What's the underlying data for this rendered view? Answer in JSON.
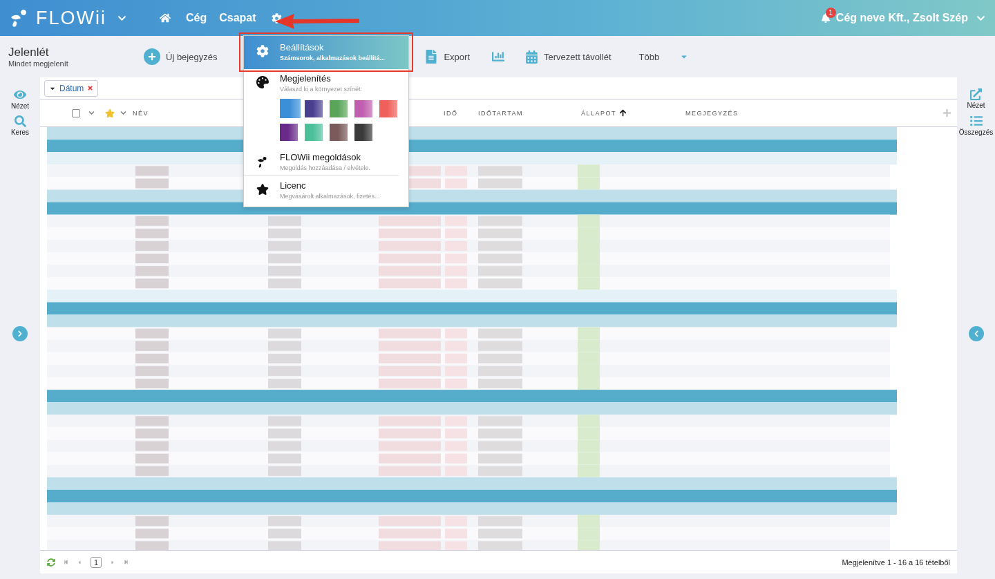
{
  "header": {
    "logo": "FLOWii",
    "nav": [
      {
        "kind": "home"
      },
      {
        "kind": "text",
        "label": "Cég"
      },
      {
        "kind": "text",
        "label": "Csapat"
      },
      {
        "kind": "settings"
      }
    ],
    "notifications": "1",
    "user": "Cég neve Kft., Zsolt Szép"
  },
  "page": {
    "title": "Jelenlét",
    "subtitle": "Mindet megjelenít"
  },
  "toolbar": [
    {
      "kind": "add",
      "label": "Új bejegyzés"
    },
    {
      "kind": "export",
      "label": "Export"
    },
    {
      "kind": "chart"
    },
    {
      "kind": "calendar",
      "label": "Tervezett távollét"
    },
    {
      "kind": "more",
      "label": "Több"
    }
  ],
  "left_sidebar": [
    {
      "kind": "eye",
      "label": "Nézet"
    },
    {
      "kind": "search",
      "label": "Keres"
    }
  ],
  "right_sidebar": [
    {
      "kind": "external",
      "label": "Nézet"
    },
    {
      "kind": "list",
      "label": "Összegzés"
    }
  ],
  "filter": {
    "label": "Dátum"
  },
  "table": {
    "columns": [
      {
        "kind": "checkbox",
        "checked": false
      },
      {
        "kind": "star"
      },
      {
        "kind": "text",
        "label": "NÉV"
      },
      {
        "kind": "text",
        "label": "IDŐ"
      },
      {
        "kind": "text",
        "label": "IDŐTARTAM"
      },
      {
        "kind": "sort",
        "label": "ÁLLAPOT"
      },
      {
        "kind": "text",
        "label": "MEGJEGYZÉS"
      }
    ]
  },
  "menu": [
    {
      "kind": "settings",
      "title": "Beállítások",
      "subtitle": "Számsorok, alkalmazások beállítá...",
      "selected": true
    },
    {
      "kind": "appearance",
      "title": "Megjelenítés",
      "subtitle": "Válaszd ki a környezet színét:",
      "selected": false,
      "swatches": [
        {
          "color": "#3b8fd9",
          "selected": true
        },
        {
          "color": "#4a3f8f",
          "selected": false
        },
        {
          "color": "#5aa55a",
          "selected": false
        },
        {
          "color": "#c05fb0",
          "selected": false
        },
        {
          "color": "#f0605a",
          "selected": false
        },
        {
          "color": "#6a2a8a",
          "selected": false
        },
        {
          "color": "#4cc09a",
          "selected": false
        },
        {
          "color": "#7a5a5a",
          "selected": false
        },
        {
          "color": "#3a3a3a",
          "selected": false
        }
      ]
    },
    {
      "kind": "solutions",
      "title": "FLOWii megoldások",
      "subtitle": "Megoldás hozzáadása / elvétele.",
      "selected": false
    },
    {
      "kind": "license",
      "title": "Licenc",
      "subtitle": "Megvásárolt alkalmazások, fizetés...",
      "selected": false
    }
  ],
  "footer": {
    "page": "1",
    "status": "Megjelenítve 1 - 16 a 16 tételből"
  }
}
